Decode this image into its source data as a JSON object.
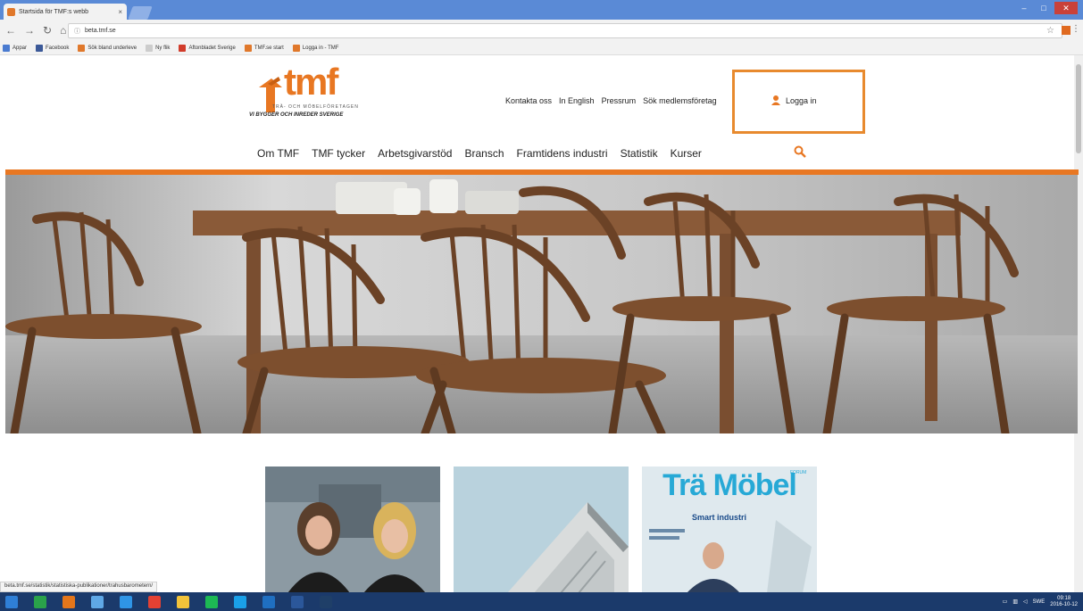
{
  "browser": {
    "tab_title": "Startsida för TMF:s webb",
    "tab_close": "×",
    "url": "beta.tmf.se",
    "window_min": "–",
    "window_max": "□",
    "window_close": "✕",
    "bookmarks": [
      {
        "label": "Appar",
        "color": "#4a7bd0"
      },
      {
        "label": "Facebook",
        "color": "#3b5998"
      },
      {
        "label": "Sök bland underleve",
        "color": "#e0782b"
      },
      {
        "label": "Ny flik",
        "color": "#cccccc"
      },
      {
        "label": "Aftonbladet Sverige",
        "color": "#d13b2a"
      },
      {
        "label": "TMF.se start",
        "color": "#e0782b"
      },
      {
        "label": "Logga in - TMF",
        "color": "#e0782b"
      }
    ]
  },
  "site": {
    "logo_text": "tmf",
    "logo_sub": "TRÄ- OCH MÖBELFÖRETAGEN",
    "logo_tag": "VI BYGGER OCH INREDER SVERIGE",
    "util_nav": [
      "Kontakta oss",
      "In English",
      "Pressrum",
      "Sök medlemsföretag"
    ],
    "login_label": "Logga in",
    "main_nav": [
      "Om TMF",
      "TMF tycker",
      "Arbetsgivarstöd",
      "Bransch",
      "Framtidens industri",
      "Statistik",
      "Kurser"
    ],
    "accent": "#e87722"
  },
  "cards": {
    "mag_title": "Trä Möbel",
    "mag_forum": "FORUM",
    "mag_headline": "Smart industri"
  },
  "status_url": "beta.tmf.se/statistik/statistiska-publikationer/trahusbarometern/",
  "taskbar": {
    "apps": [
      {
        "name": "start",
        "color": "#2f7fd6"
      },
      {
        "name": "store",
        "color": "#2aa24a"
      },
      {
        "name": "firefox",
        "color": "#e4761b"
      },
      {
        "name": "chrome-alt",
        "color": "#5fa8e6"
      },
      {
        "name": "ie",
        "color": "#2f95e6"
      },
      {
        "name": "chrome",
        "color": "#e34133"
      },
      {
        "name": "files",
        "color": "#f2c33a"
      },
      {
        "name": "spotify",
        "color": "#1db954"
      },
      {
        "name": "skype",
        "color": "#1aa0e8"
      },
      {
        "name": "outlook",
        "color": "#1f6fc1"
      },
      {
        "name": "word",
        "color": "#2b579a"
      },
      {
        "name": "photoshop",
        "color": "#1f3f68"
      }
    ],
    "lang": "SWE",
    "time": "09:18",
    "date": "2016-10-12"
  }
}
